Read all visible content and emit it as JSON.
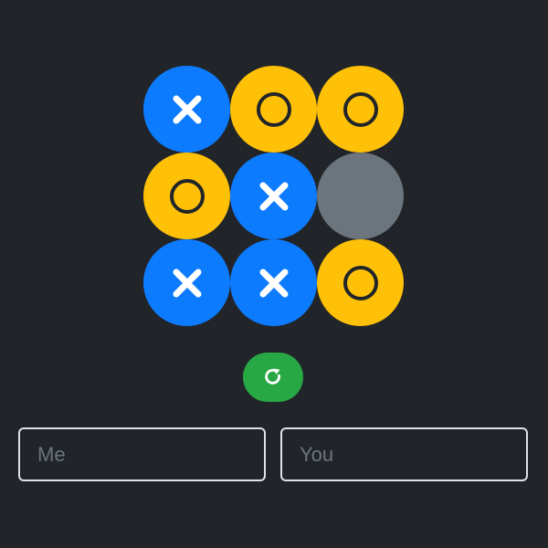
{
  "board": {
    "cells": [
      "X",
      "O",
      "O",
      "O",
      "X",
      "",
      "X",
      "X",
      "O"
    ],
    "colors": {
      "x": "#0d7bfe",
      "o": "#ffc107",
      "empty": "#6c757d",
      "mark": "#212529"
    }
  },
  "controls": {
    "reset_icon": "refresh-icon",
    "reset_color": "#28a745"
  },
  "players": {
    "player1_placeholder": "Me",
    "player1_value": "",
    "player2_placeholder": "You",
    "player2_value": ""
  }
}
